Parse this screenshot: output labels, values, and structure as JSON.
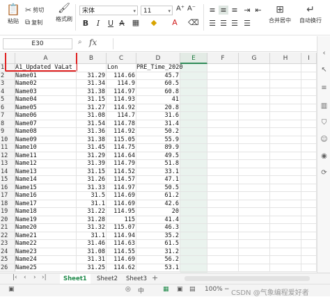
{
  "toolbar": {
    "paste": "粘贴",
    "cut": "剪切",
    "copy": "复制",
    "format_painter": "格式刷",
    "font_name": "宋体",
    "font_size": "11",
    "font_grow": "A⁺",
    "font_shrink": "A⁻",
    "bold": "B",
    "italic": "I",
    "underline": "U",
    "merge_center": "合并居中",
    "wrap_text": "自动换行"
  },
  "formula_bar": {
    "cell_ref": "E30",
    "fx": "fx",
    "value": ""
  },
  "columns": [
    "A",
    "B",
    "C",
    "D",
    "E",
    "F",
    "G",
    "H",
    "I"
  ],
  "active_column": "E",
  "rows": [
    {
      "n": "1",
      "a": "A1_Updated VaLat",
      "b": "",
      "c": "Lon",
      "d": "PRE_Time_2020"
    },
    {
      "n": "2",
      "a": "Name01",
      "b": "31.29",
      "c": "114.66",
      "d": "45.7"
    },
    {
      "n": "3",
      "a": "Name02",
      "b": "31.34",
      "c": "114.9",
      "d": "60.5"
    },
    {
      "n": "4",
      "a": "Name03",
      "b": "31.38",
      "c": "114.97",
      "d": "60.8"
    },
    {
      "n": "5",
      "a": "Name04",
      "b": "31.15",
      "c": "114.93",
      "d": "41"
    },
    {
      "n": "6",
      "a": "Name05",
      "b": "31.27",
      "c": "114.92",
      "d": "20.8"
    },
    {
      "n": "7",
      "a": "Name06",
      "b": "31.08",
      "c": "114.7",
      "d": "31.6"
    },
    {
      "n": "8",
      "a": "Name07",
      "b": "31.54",
      "c": "114.78",
      "d": "31.4"
    },
    {
      "n": "9",
      "a": "Name08",
      "b": "31.36",
      "c": "114.92",
      "d": "50.2"
    },
    {
      "n": "10",
      "a": "Name09",
      "b": "31.38",
      "c": "115.05",
      "d": "55.9"
    },
    {
      "n": "11",
      "a": "Name10",
      "b": "31.45",
      "c": "114.75",
      "d": "89.9"
    },
    {
      "n": "12",
      "a": "Name11",
      "b": "31.29",
      "c": "114.64",
      "d": "49.5"
    },
    {
      "n": "13",
      "a": "Name12",
      "b": "31.39",
      "c": "114.79",
      "d": "51.8"
    },
    {
      "n": "14",
      "a": "Name13",
      "b": "31.15",
      "c": "114.52",
      "d": "33.1"
    },
    {
      "n": "15",
      "a": "Name14",
      "b": "31.26",
      "c": "114.57",
      "d": "47.1"
    },
    {
      "n": "16",
      "a": "Name15",
      "b": "31.33",
      "c": "114.97",
      "d": "50.5"
    },
    {
      "n": "17",
      "a": "Name16",
      "b": "31.5",
      "c": "114.69",
      "d": "61.2"
    },
    {
      "n": "18",
      "a": "Name17",
      "b": "31.1",
      "c": "114.69",
      "d": "42.6"
    },
    {
      "n": "19",
      "a": "Name18",
      "b": "31.22",
      "c": "114.95",
      "d": "20"
    },
    {
      "n": "20",
      "a": "Name19",
      "b": "31.28",
      "c": "115",
      "d": "41.4"
    },
    {
      "n": "21",
      "a": "Name20",
      "b": "31.32",
      "c": "115.07",
      "d": "46.3"
    },
    {
      "n": "22",
      "a": "Name21",
      "b": "31.1",
      "c": "114.94",
      "d": "35.2"
    },
    {
      "n": "23",
      "a": "Name22",
      "b": "31.46",
      "c": "114.63",
      "d": "61.5"
    },
    {
      "n": "24",
      "a": "Name23",
      "b": "31.08",
      "c": "114.55",
      "d": "31.2"
    },
    {
      "n": "25",
      "a": "Name24",
      "b": "31.31",
      "c": "114.69",
      "d": "56.2"
    },
    {
      "n": "26",
      "a": "Name25",
      "b": "31.25",
      "c": "114.62",
      "d": "53.1"
    }
  ],
  "sheets": [
    "Sheet1",
    "Sheet2",
    "Sheet3"
  ],
  "active_sheet": "Sheet1",
  "status": {
    "zoom": "100%",
    "zoom_minus": "−",
    "watermark": "CSDN @气象编程爱好者"
  },
  "colors": {
    "accent": "#1f8a4a",
    "highlight_box": "#e02020"
  }
}
